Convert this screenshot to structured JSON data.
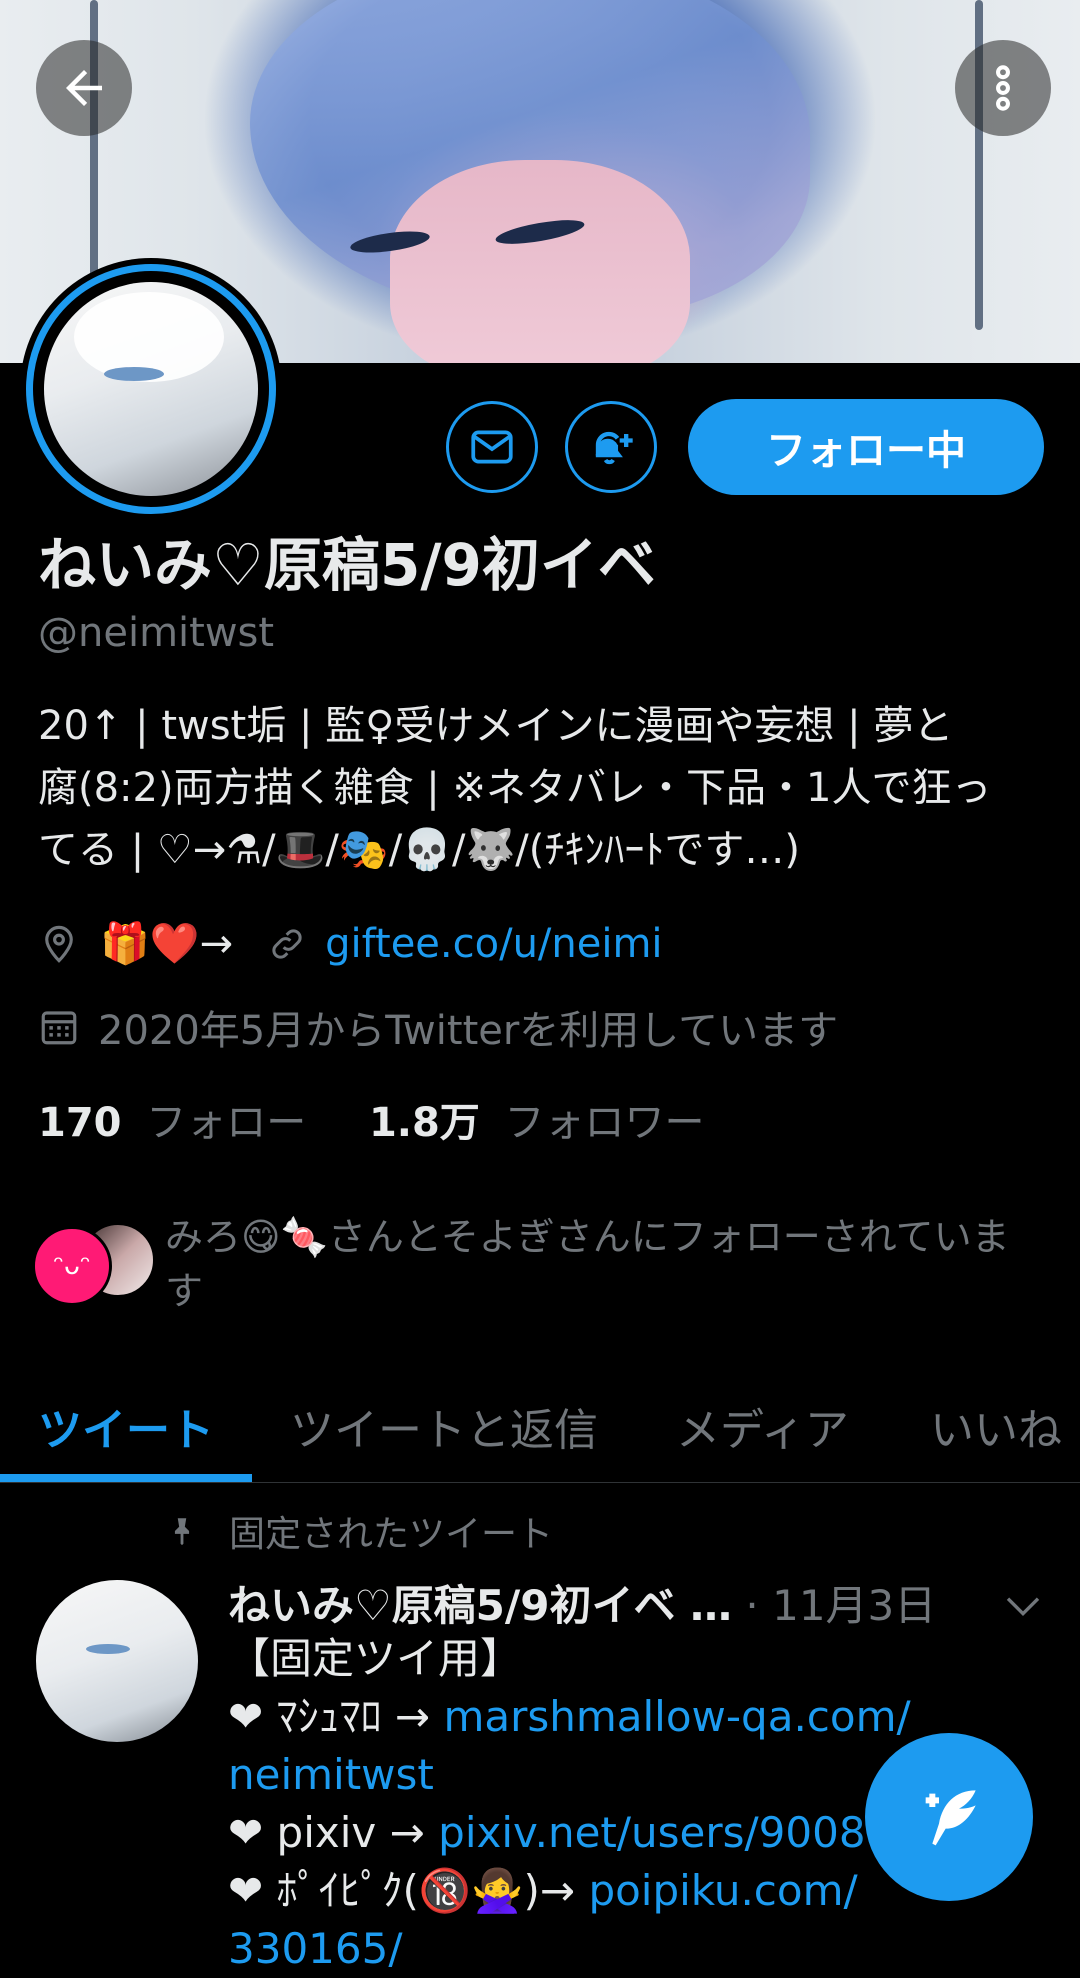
{
  "header": {
    "back_icon": "arrow-left-icon",
    "more_icon": "more-vertical-icon"
  },
  "actions": {
    "message_icon": "mail-icon",
    "notify_icon": "bell-plus-icon",
    "follow_label": "フォロー中"
  },
  "profile": {
    "name": "ねいみ♡原稿5/9初イベ",
    "handle": "@neimitwst",
    "bio_line1": "20↑ | twst垢 | 監♀受けメインに漫画や妄想 | 夢と",
    "bio_line2": "腐(8:2)両方描く雑食 | ※ネタバレ・下品・1人で狂っ",
    "bio_line3": "てる | ♡→⚗/🎩/🎭/💀/🐺/(ﾁｷﾝﾊｰﾄです…)",
    "location_text": "🎁❤️→",
    "website": "giftee.co/u/neimi",
    "joined": "2020年5月からTwitterを利用しています"
  },
  "stats": {
    "following_count": "170",
    "following_label": "フォロー",
    "followers_count": "1.8万",
    "followers_label": "フォロワー"
  },
  "followed_by": {
    "text": "みろ😋🍬さんとそよぎさんにフォローされています",
    "avatar1_text": "ᵔᴗᵔ"
  },
  "tabs": [
    {
      "label": "ツイート"
    },
    {
      "label": "ツイートと返信"
    },
    {
      "label": "メディア"
    },
    {
      "label": "いいね"
    }
  ],
  "tweet": {
    "pinned_label": "固定されたツイート",
    "author": "ねいみ♡原稿5/9初イベ …",
    "date": " · 11月3日",
    "line1": "【固定ツイ用】",
    "line2_prefix": "❤ ﾏｼｭﾏﾛ → ",
    "line2_link": "marshmallow-qa.com/",
    "line3_link": "neimitwst",
    "line4_prefix": "❤ pixiv → ",
    "line4_link": "pixiv.net/users/90086",
    "line5_prefix": "❤ ﾎﾟｲﾋﾟｸ(🔞🙅‍♀️)→ ",
    "line5_link": "poipiku.com/",
    "line6_link": "330165/"
  },
  "colors": {
    "accent": "#1d9bf0",
    "background": "#000000",
    "muted": "#71767b",
    "text": "#e7e9ea"
  }
}
